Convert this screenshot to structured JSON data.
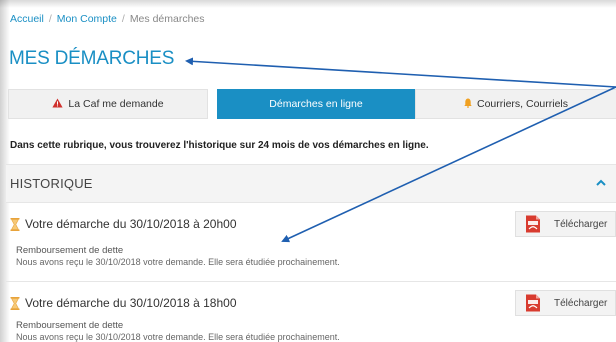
{
  "breadcrumb": {
    "items": [
      "Accueil",
      "Mon Compte",
      "Mes démarches"
    ],
    "separator": "/"
  },
  "page": {
    "title": "MES DÉMARCHES"
  },
  "tabs": [
    {
      "label": "La Caf me demande",
      "icon": "warning-icon",
      "active": false
    },
    {
      "label": "Démarches en ligne",
      "active": true
    },
    {
      "label": "Courriers, Courriels",
      "icon": "bell-icon",
      "active": false
    }
  ],
  "intro": "Dans cette rubrique, vous trouverez l'historique sur 24 mois de vos démarches en ligne.",
  "history": {
    "title": "HISTORIQUE",
    "collapse_icon": "chevron-up-icon",
    "entries": [
      {
        "title": "Votre démarche du 30/10/2018 à 20h00",
        "type": "Remboursement de dette",
        "message": "Nous avons reçu le 30/10/2018 votre demande. Elle sera étudiée prochainement.",
        "download_label": "Télécharger"
      },
      {
        "title": "Votre démarche du 30/10/2018 à 18h00",
        "type": "Remboursement de dette",
        "message": "Nous avons reçu le 30/10/2018 votre demande. Elle sera étudiée prochainement.",
        "download_label": "Télécharger"
      }
    ]
  },
  "colors": {
    "accent": "#1a8fc4",
    "warning": "#d0312d",
    "bell": "#f0a020",
    "hourglass": "#e8a33a",
    "pdf": "#d83b2f",
    "annotation_arrow": "#1f5fb0"
  }
}
